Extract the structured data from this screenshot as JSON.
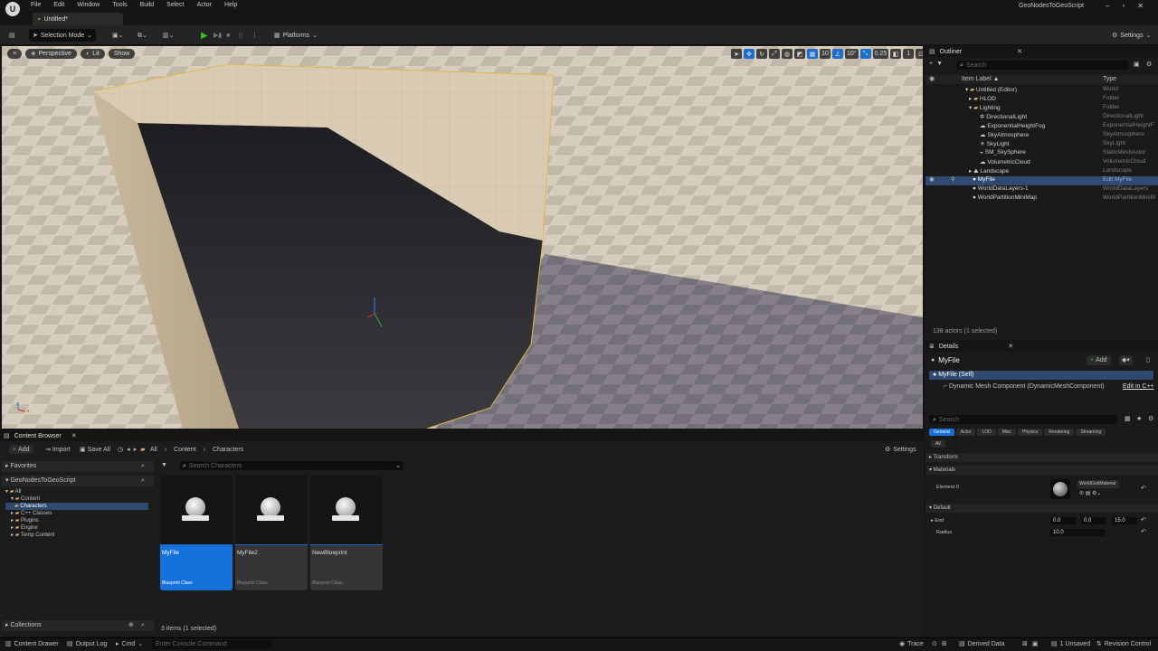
{
  "app": {
    "logo": "U",
    "menu": [
      "File",
      "Edit",
      "Window",
      "Tools",
      "Build",
      "Select",
      "Actor",
      "Help"
    ],
    "project_name": "GeoNodesToGeoScript",
    "document_tab": "Untitled*"
  },
  "toolbar": {
    "selection_mode": "Selection Mode",
    "platforms": "Platforms",
    "settings": "Settings"
  },
  "viewport": {
    "perspective": "Perspective",
    "lit": "Lit",
    "show": "Show",
    "grid_snap": "10",
    "rotation_snap": "10°",
    "scale_snap": "0.25",
    "camera_speed": "1",
    "axis_z": "z",
    "axis_x": "x"
  },
  "outliner": {
    "tab": "Outliner",
    "search_placeholder": "Search",
    "col_label": "Item Label ▲",
    "col_type": "Type",
    "rows": [
      {
        "label": "Untitled (Editor)",
        "type": "World"
      },
      {
        "label": "HLOD",
        "type": "Folder"
      },
      {
        "label": "Lighting",
        "type": "Folder"
      },
      {
        "label": "DirectionalLight",
        "type": "DirectionalLight"
      },
      {
        "label": "ExponentialHeightFog",
        "type": "ExponentialHeightF"
      },
      {
        "label": "SkyAtmosphere",
        "type": "SkyAtmosphere"
      },
      {
        "label": "SkyLight",
        "type": "SkyLight"
      },
      {
        "label": "SM_SkySphere",
        "type": "StaticMeshActor"
      },
      {
        "label": "VolumetricCloud",
        "type": "VolumetricCloud"
      },
      {
        "label": "Landscape",
        "type": "Landscape"
      },
      {
        "label": "MyFile",
        "type": "Edit MyFile"
      },
      {
        "label": "WorldDataLayers-1",
        "type": "WorldDataLayers"
      },
      {
        "label": "WorldPartitionMiniMap",
        "type": "WorldPartitionMiniM"
      }
    ],
    "status": "138 actors (1 selected)"
  },
  "details": {
    "tab": "Details",
    "actor_name": "MyFile",
    "add": "Add",
    "self": "MyFile (Self)",
    "component": "Dynamic Mesh Component (DynamicMeshComponent)",
    "edit_cpp": "Edit in C++",
    "search_placeholder": "Search",
    "filters": [
      "General",
      "Actor",
      "LOD",
      "Misc",
      "Physics",
      "Rendering",
      "Streaming"
    ],
    "filter_all": "All",
    "cat_transform": "Transform",
    "cat_materials": "Materials",
    "element0": "Element 0",
    "material_name": "WorldGridMaterial",
    "cat_default": "Default",
    "end_label": "End",
    "end_values": [
      "0.0",
      "0.0",
      "15.0"
    ],
    "radius_label": "Radius",
    "radius_value": "10.0"
  },
  "content_browser": {
    "tab": "Content Browser",
    "add": "Add",
    "import": "Import",
    "save_all": "Save All",
    "breadcrumb": [
      "All",
      "Content",
      "Characters"
    ],
    "settings": "Settings",
    "favorites": "Favorites",
    "project": "GeoNodesToGeoScript",
    "search_placeholder": "Search Characters",
    "tree": [
      "All",
      "Content",
      "Characters",
      "C++ Classes",
      "Plugins",
      "Engine",
      "Temp Content"
    ],
    "assets": [
      {
        "name": "MyFile",
        "class": "Blueprint Class"
      },
      {
        "name": "MyFile2",
        "class": "Blueprint Class"
      },
      {
        "name": "NewBlueprint",
        "class": "Blueprint Class"
      }
    ],
    "collections": "Collections",
    "status": "3 items (1 selected)"
  },
  "statusbar": {
    "content_drawer": "Content Drawer",
    "output_log": "Output Log",
    "cmd": "Cmd",
    "console_placeholder": "Enter Console Command",
    "trace": "Trace",
    "derived_data": "Derived Data",
    "unsaved": "1 Unsaved",
    "revision_control": "Revision Control"
  },
  "colors": {
    "accent": "#1672db",
    "selection_row": "#2f4a6e",
    "play_green": "#2fbf2f"
  }
}
